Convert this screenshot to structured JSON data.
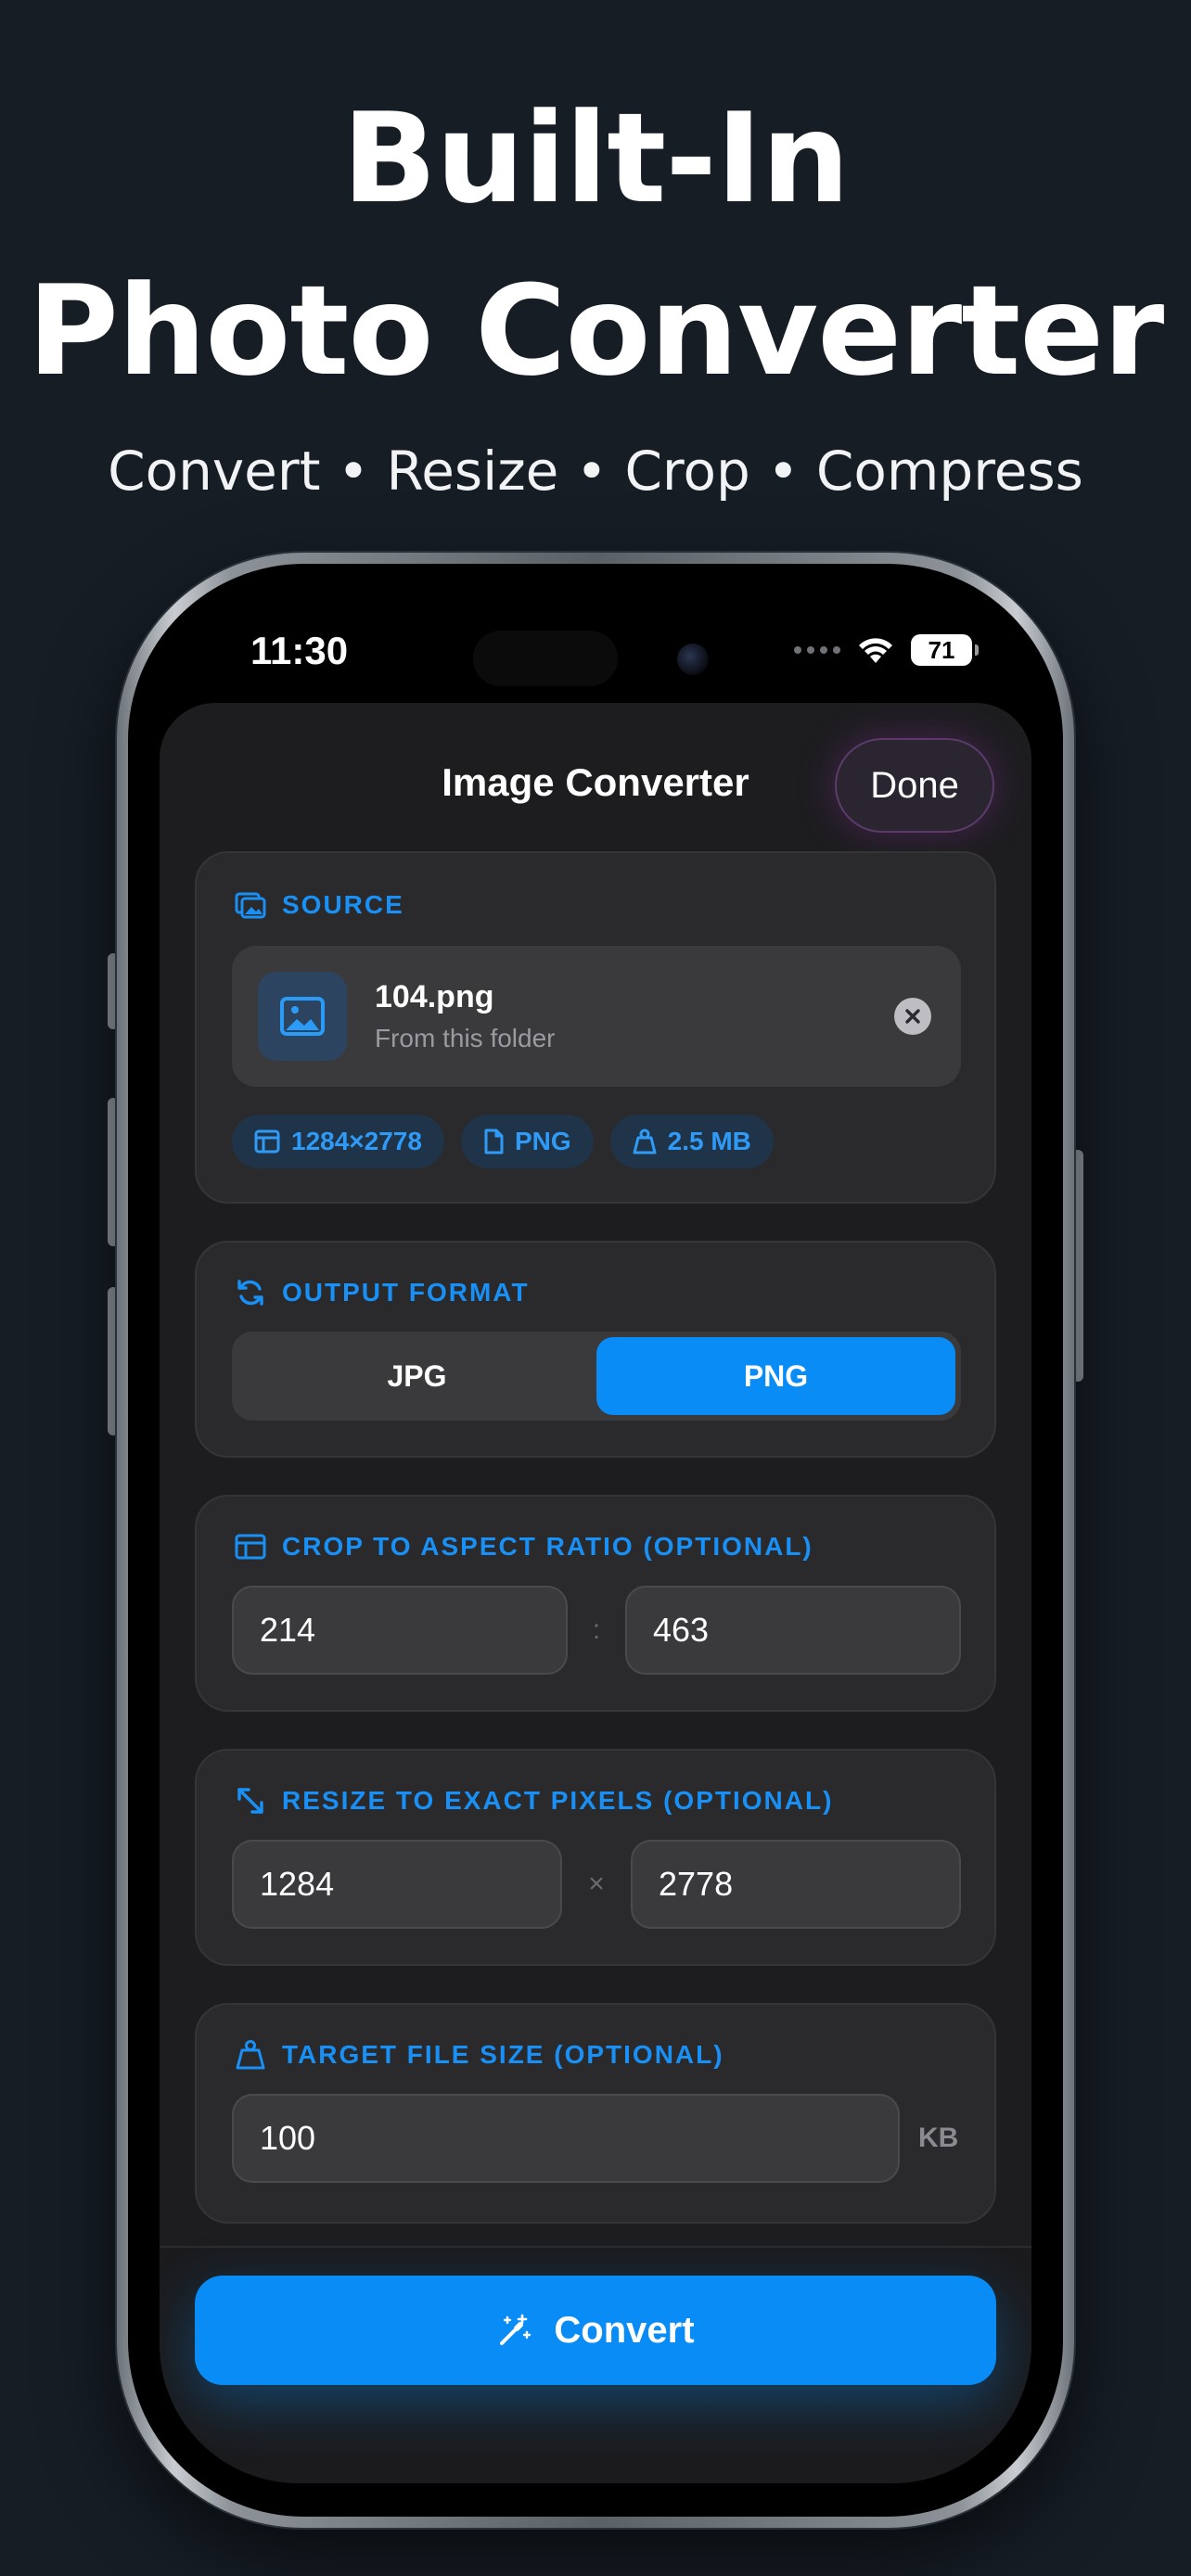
{
  "promo": {
    "title_line1": "Built-In",
    "title_line2": "Photo Converter",
    "subtitle": "Convert • Resize • Crop • Compress"
  },
  "status_bar": {
    "time": "11:30",
    "battery": "71"
  },
  "sheet": {
    "title": "Image Converter",
    "done_label": "Done"
  },
  "source": {
    "header": "SOURCE",
    "file_name": "104.png",
    "file_location": "From this folder",
    "chips": [
      "1284×2778",
      "PNG",
      "2.5 MB"
    ]
  },
  "output_format": {
    "header": "OUTPUT FORMAT",
    "options": [
      "JPG",
      "PNG"
    ],
    "selected": "PNG"
  },
  "crop": {
    "header": "CROP TO ASPECT RATIO (OPTIONAL)",
    "width_value": "214",
    "height_value": "463",
    "separator": ":"
  },
  "resize": {
    "header": "RESIZE TO EXACT PIXELS (OPTIONAL)",
    "width_value": "1284",
    "height_value": "2778",
    "separator": "×"
  },
  "target_size": {
    "header": "TARGET FILE SIZE (OPTIONAL)",
    "value": "100",
    "unit": "KB"
  },
  "actions": {
    "convert_label": "Convert"
  },
  "colors": {
    "accent": "#0a8cf7",
    "background": "#161d25",
    "card": "#2a2a2c"
  }
}
